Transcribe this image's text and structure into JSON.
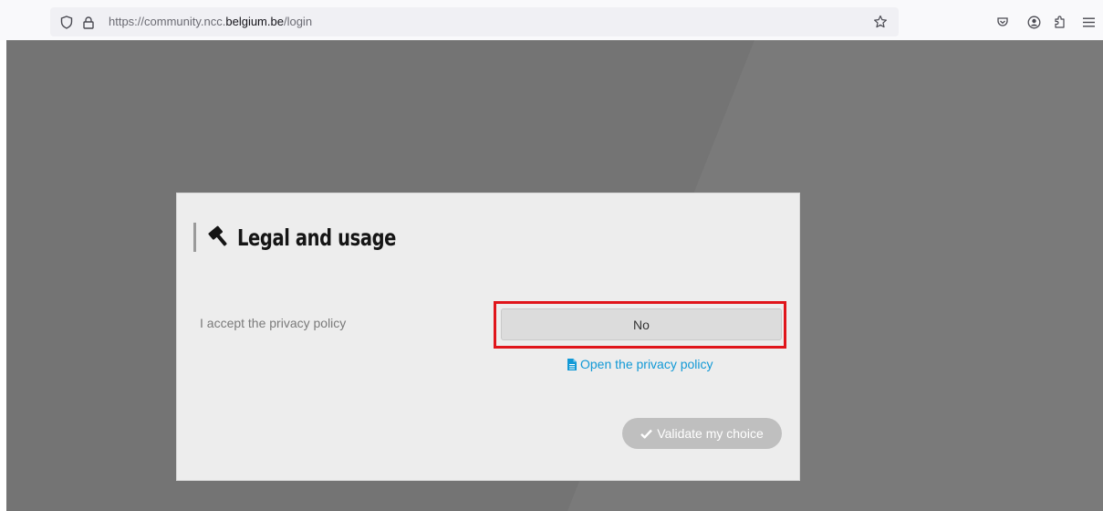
{
  "browser": {
    "url_prefix": "https://community.ncc.",
    "url_host": "belgium.be",
    "url_path": "/login",
    "icons": [
      "shield-icon",
      "lock-icon",
      "star-icon",
      "pocket-icon",
      "account-icon",
      "extensions-icon",
      "menu-icon"
    ]
  },
  "modal": {
    "title": "Legal and usage",
    "title_icon": "gavel-icon",
    "field_label": "I accept the privacy policy",
    "toggle_value": "No",
    "policy_link": "Open the privacy policy",
    "validate_label": "Validate my choice"
  },
  "colors": {
    "overlay": "#747474",
    "highlight": "#e0151b",
    "link": "#1199d6",
    "validate_disabled": "#bfbfbf"
  }
}
